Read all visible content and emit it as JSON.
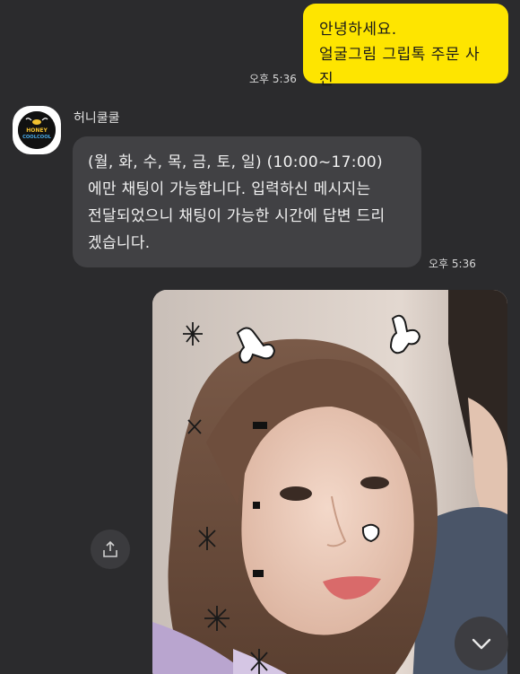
{
  "outgoing": {
    "lines": [
      "안녕하세요.",
      "얼굴그림 그립톡 주문 사진"
    ],
    "time": "오후 5:36"
  },
  "incoming": {
    "sender": "허니쿨쿨",
    "avatar_text": [
      "HONEY",
      "COOLCOOL"
    ],
    "lines": [
      "(월, 화, 수, 목, 금, 토, 일) (10:00~17:00)",
      "에만 채팅이 가능합니다. 입력하신 메시지는",
      "전달되었으니 채팅이 가능한 시간에 답변 드리",
      "겠습니다."
    ],
    "time": "오후 5:36"
  },
  "image_message": {
    "alt": "photo"
  },
  "icons": {
    "share": "share-icon",
    "scroll_down": "chevron-down-icon"
  },
  "colors": {
    "background": "#2b2b2d",
    "outgoing_bubble": "#fee500",
    "incoming_bubble": "#414144"
  }
}
